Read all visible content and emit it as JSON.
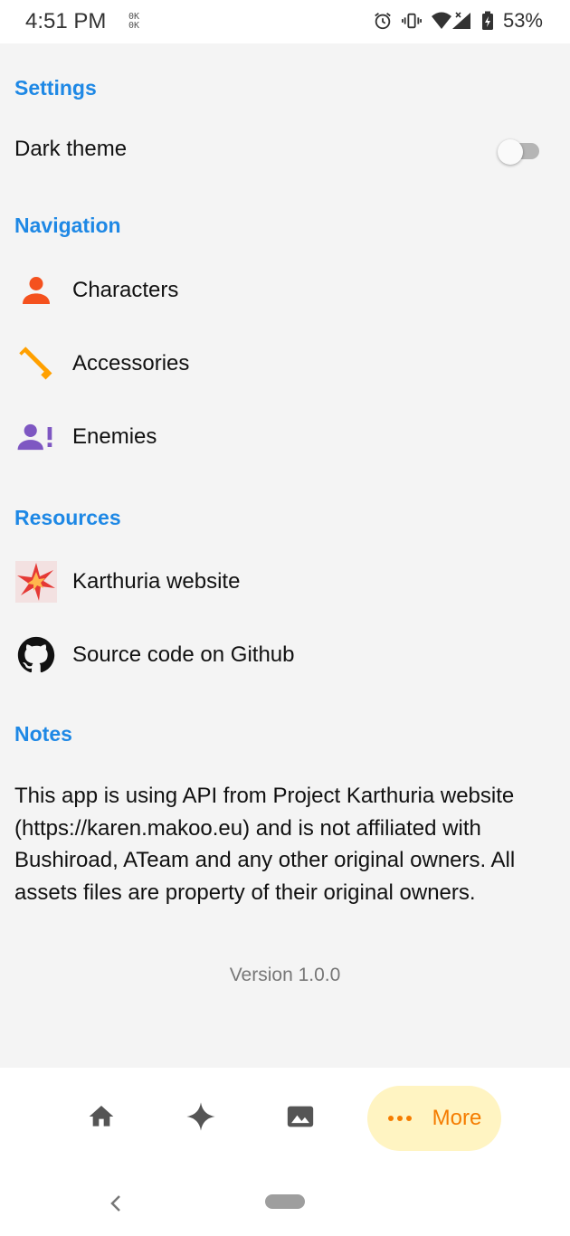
{
  "status_bar": {
    "time": "4:51 PM",
    "speed_top": "0K",
    "speed_bottom": "0K",
    "battery": "53%"
  },
  "settings": {
    "title": "Settings",
    "dark_theme_label": "Dark theme",
    "dark_theme_enabled": false
  },
  "navigation": {
    "title": "Navigation",
    "items": [
      {
        "label": "Characters",
        "icon": "person-icon",
        "color": "#f4511e"
      },
      {
        "label": "Accessories",
        "icon": "sword-icon",
        "color": "#ffa000"
      },
      {
        "label": "Enemies",
        "icon": "person-alert-icon",
        "color": "#7e57c2"
      }
    ]
  },
  "resources": {
    "title": "Resources",
    "items": [
      {
        "label": "Karthuria website",
        "icon": "karthuria-logo-icon"
      },
      {
        "label": "Source code on Github",
        "icon": "github-icon"
      }
    ]
  },
  "notes": {
    "title": "Notes",
    "text": "This app is using API from Project Karthuria website (https://karen.makoo.eu) and is not affiliated with Bushiroad, ATeam and any other original owners. All assets files are property of their original owners."
  },
  "version": "Version 1.0.0",
  "bottom_nav": {
    "items": [
      {
        "icon": "home-icon"
      },
      {
        "icon": "sparkle-icon"
      },
      {
        "icon": "image-icon"
      }
    ],
    "active_label": "More",
    "active_icon": "more-dots-icon"
  },
  "colors": {
    "section_title": "#1e88e5",
    "active_nav_bg": "#fff4c2",
    "active_nav_fg": "#f57c00"
  }
}
